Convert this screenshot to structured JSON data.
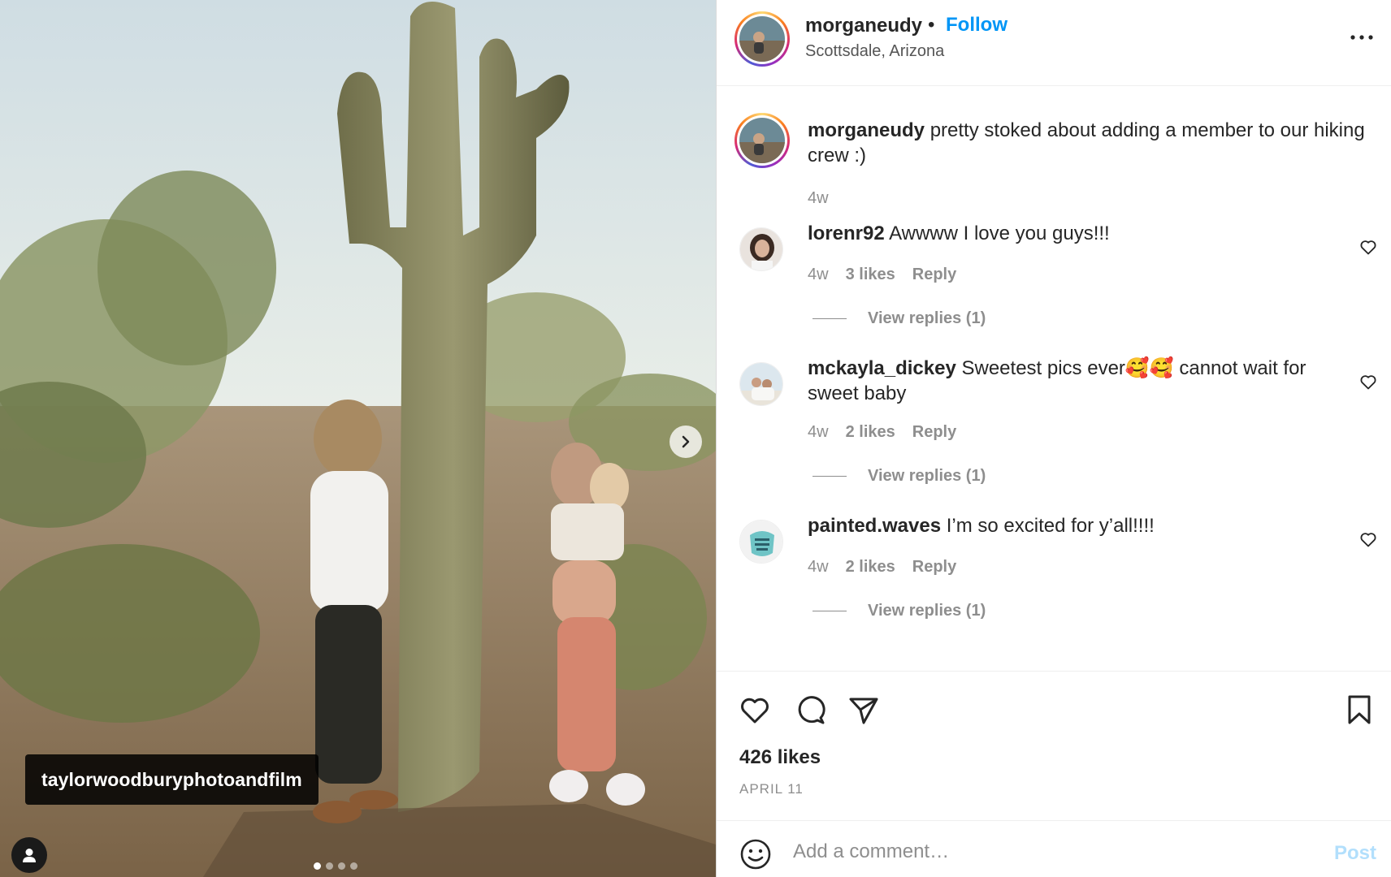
{
  "post": {
    "photo_tag": "taylorwoodburyphotoandfilm",
    "carousel": {
      "total": 4,
      "active_index": 0
    }
  },
  "header": {
    "username": "morganeudy",
    "separator": "•",
    "follow_label": "Follow",
    "location": "Scottsdale, Arizona"
  },
  "caption": {
    "username": "morganeudy",
    "text": "pretty stoked about adding a member to our hiking crew :)",
    "time": "4w"
  },
  "comments": [
    {
      "username": "lorenr92",
      "text": "Awwww I love you guys!!!",
      "time": "4w",
      "likes": "3 likes",
      "reply_label": "Reply",
      "view_replies": "View replies (1)"
    },
    {
      "username": "mckayla_dickey",
      "text": "Sweetest pics ever🥰🥰 cannot wait for sweet baby",
      "time": "4w",
      "likes": "2 likes",
      "reply_label": "Reply",
      "view_replies": "View replies (1)"
    },
    {
      "username": "painted.waves",
      "text": "I’m so excited for y’all!!!!",
      "time": "4w",
      "likes": "2 likes",
      "reply_label": "Reply",
      "view_replies": "View replies (1)"
    }
  ],
  "actions": {
    "likes": "426 likes",
    "date": "APRIL 11"
  },
  "comment_box": {
    "placeholder": "Add a comment…",
    "post_label": "Post"
  },
  "colors": {
    "link_blue": "#0095f6",
    "post_disabled": "#b2dffc",
    "muted": "#8e8e8e",
    "text": "#262626"
  },
  "icons": [
    "chevron-right-icon",
    "user-tag-icon",
    "more-icon",
    "heart-icon",
    "comment-icon",
    "share-icon",
    "bookmark-icon",
    "emoji-icon"
  ]
}
